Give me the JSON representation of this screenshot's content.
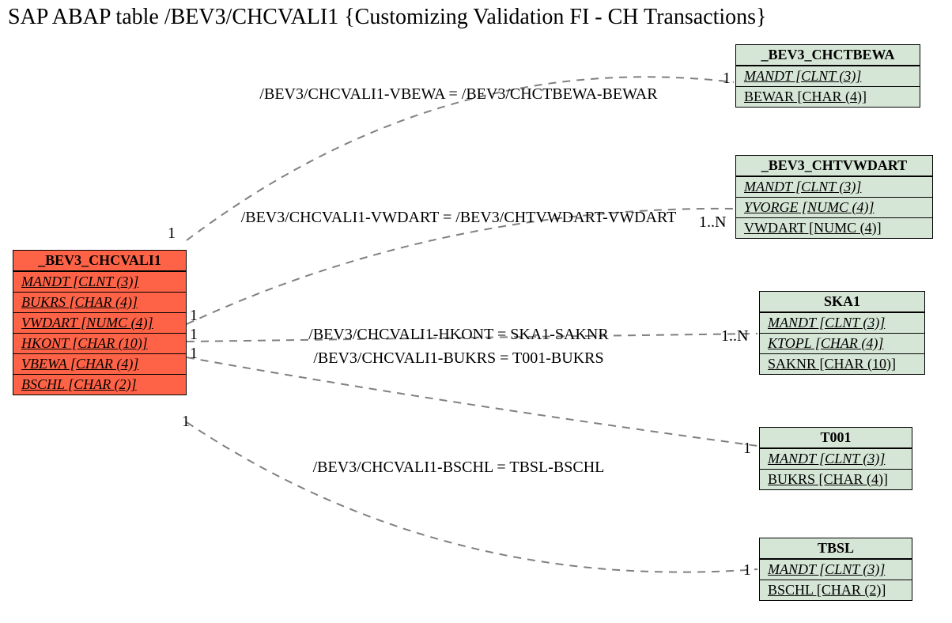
{
  "title": "SAP ABAP table /BEV3/CHCVALI1 {Customizing Validation FI - CH Transactions}",
  "source": {
    "name": "_BEV3_CHCVALI1",
    "fields": [
      {
        "key": true,
        "text": "MANDT [CLNT (3)]"
      },
      {
        "key": true,
        "text": "BUKRS [CHAR (4)]"
      },
      {
        "key": true,
        "text": "VWDART [NUMC (4)]"
      },
      {
        "key": true,
        "text": "HKONT [CHAR (10)]"
      },
      {
        "key": true,
        "text": "VBEWA [CHAR (4)]"
      },
      {
        "key": true,
        "text": "BSCHL [CHAR (2)]"
      }
    ]
  },
  "targets": [
    {
      "name": "_BEV3_CHCTBEWA",
      "fields": [
        {
          "key": true,
          "text": "MANDT [CLNT (3)]"
        },
        {
          "key": false,
          "text": "BEWAR [CHAR (4)]"
        }
      ]
    },
    {
      "name": "_BEV3_CHTVWDART",
      "fields": [
        {
          "key": true,
          "text": "MANDT [CLNT (3)]"
        },
        {
          "key": true,
          "text": "YVORGE [NUMC (4)]"
        },
        {
          "key": false,
          "text": "VWDART [NUMC (4)]"
        }
      ]
    },
    {
      "name": "SKA1",
      "fields": [
        {
          "key": true,
          "text": "MANDT [CLNT (3)]"
        },
        {
          "key": true,
          "text": "KTOPL [CHAR (4)]"
        },
        {
          "key": false,
          "text": "SAKNR [CHAR (10)]"
        }
      ]
    },
    {
      "name": "T001",
      "fields": [
        {
          "key": true,
          "text": "MANDT [CLNT (3)]"
        },
        {
          "key": false,
          "text": "BUKRS [CHAR (4)]"
        }
      ]
    },
    {
      "name": "TBSL",
      "fields": [
        {
          "key": true,
          "text": "MANDT [CLNT (3)]"
        },
        {
          "key": false,
          "text": "BSCHL [CHAR (2)]"
        }
      ]
    }
  ],
  "edges": [
    {
      "label": "/BEV3/CHCVALI1-VBEWA = /BEV3/CHCTBEWA-BEWAR",
      "src_card": "1",
      "tgt_card": "1"
    },
    {
      "label": "/BEV3/CHCVALI1-VWDART = /BEV3/CHTVWDART-VWDART",
      "src_card": "1",
      "tgt_card": "1..N"
    },
    {
      "label": "/BEV3/CHCVALI1-HKONT = SKA1-SAKNR",
      "src_card": "1",
      "tgt_card": "1..N"
    },
    {
      "label": "/BEV3/CHCVALI1-BUKRS = T001-BUKRS",
      "src_card": "1",
      "tgt_card": "1"
    },
    {
      "label": "/BEV3/CHCVALI1-BSCHL = TBSL-BSCHL",
      "src_card": "1",
      "tgt_card": "1"
    }
  ]
}
